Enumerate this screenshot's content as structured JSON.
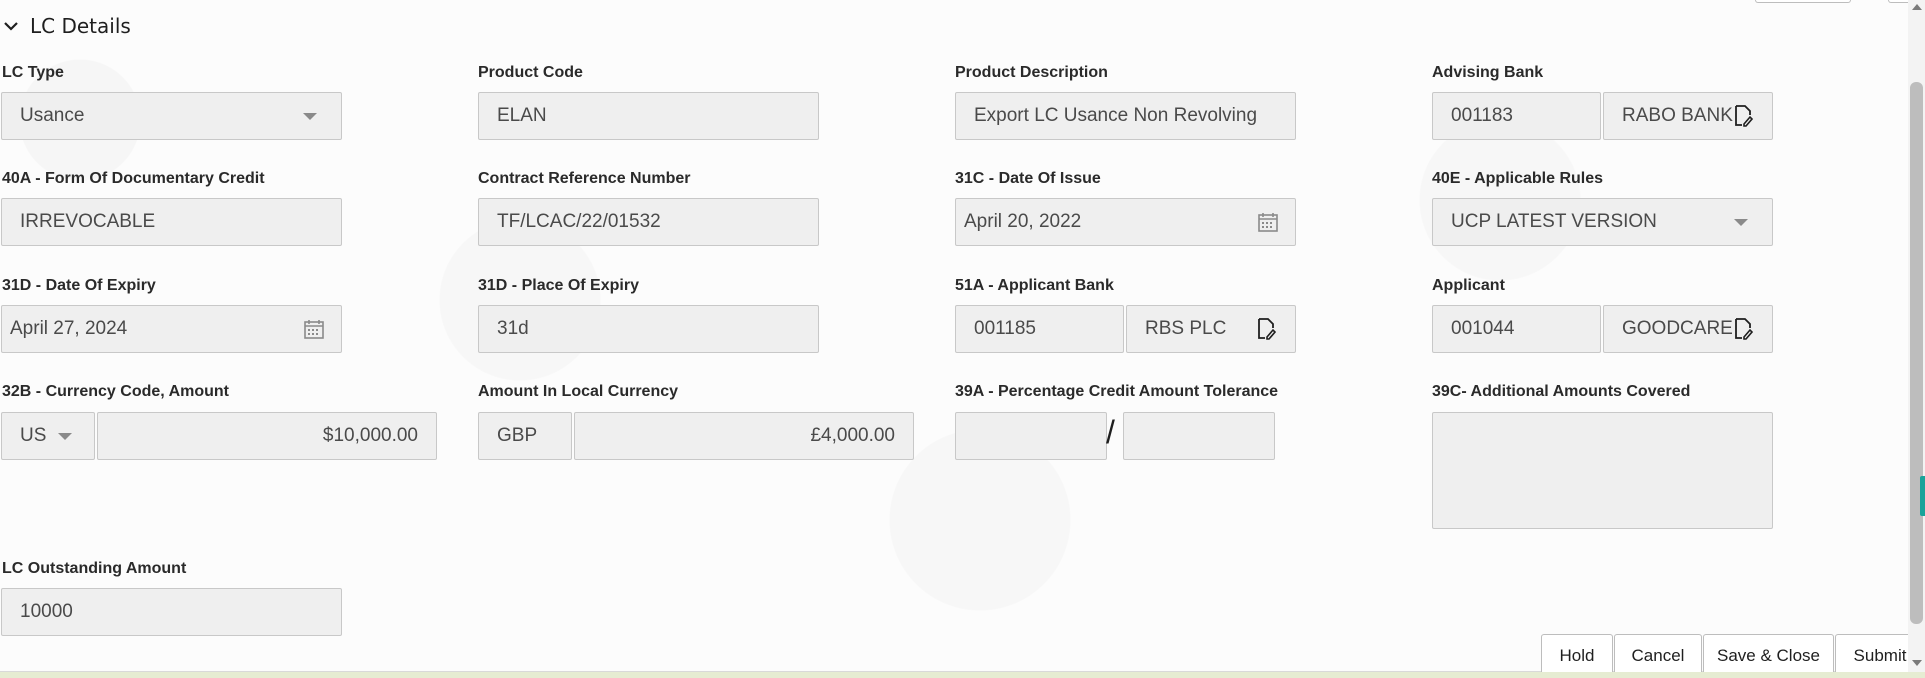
{
  "section": {
    "title": "LC Details",
    "chevron_icon": "chevron-down-icon"
  },
  "fields": {
    "lc_type": {
      "label": "LC Type",
      "value": "Usance"
    },
    "product_code": {
      "label": "Product Code",
      "value": "ELAN"
    },
    "product_description": {
      "label": "Product Description",
      "value": "Export LC Usance Non Revolving"
    },
    "advising_bank": {
      "label": "Advising Bank",
      "code": "001183",
      "name": "RABO BANK"
    },
    "form_of_credit": {
      "label": "40A - Form Of Documentary Credit",
      "value": "IRREVOCABLE"
    },
    "contract_ref": {
      "label": "Contract Reference Number",
      "value": "TF/LCAC/22/01532"
    },
    "date_of_issue": {
      "label": "31C - Date Of Issue",
      "value": "April 20, 2022"
    },
    "applicable_rules": {
      "label": "40E - Applicable Rules",
      "value": "UCP LATEST VERSION"
    },
    "date_of_expiry": {
      "label": "31D - Date Of Expiry",
      "value": "April 27, 2024"
    },
    "place_of_expiry": {
      "label": "31D - Place Of Expiry",
      "value": "31d"
    },
    "applicant_bank": {
      "label": "51A - Applicant Bank",
      "code": "001185",
      "name": "RBS PLC"
    },
    "applicant": {
      "label": "Applicant",
      "code": "001044",
      "name": "GOODCARE"
    },
    "currency_amount": {
      "label": "32B - Currency Code, Amount",
      "currency": "US",
      "amount": "$10,000.00"
    },
    "local_amount": {
      "label": "Amount In Local Currency",
      "currency": "GBP",
      "amount": "£4,000.00"
    },
    "tolerance": {
      "label": "39A - Percentage Credit Amount Tolerance",
      "separator": "/",
      "plus": "",
      "minus": ""
    },
    "additional_amounts": {
      "label": "39C- Additional Amounts Covered",
      "value": ""
    },
    "outstanding": {
      "label": "LC Outstanding Amount",
      "value": "10000"
    }
  },
  "buttons": {
    "hold": "Hold",
    "cancel": "Cancel",
    "save_close": "Save & Close",
    "submit": "Submit"
  },
  "colors": {
    "field_bg": "#efefef",
    "field_border": "#c8c8c8",
    "accent": "#1aa39a"
  }
}
